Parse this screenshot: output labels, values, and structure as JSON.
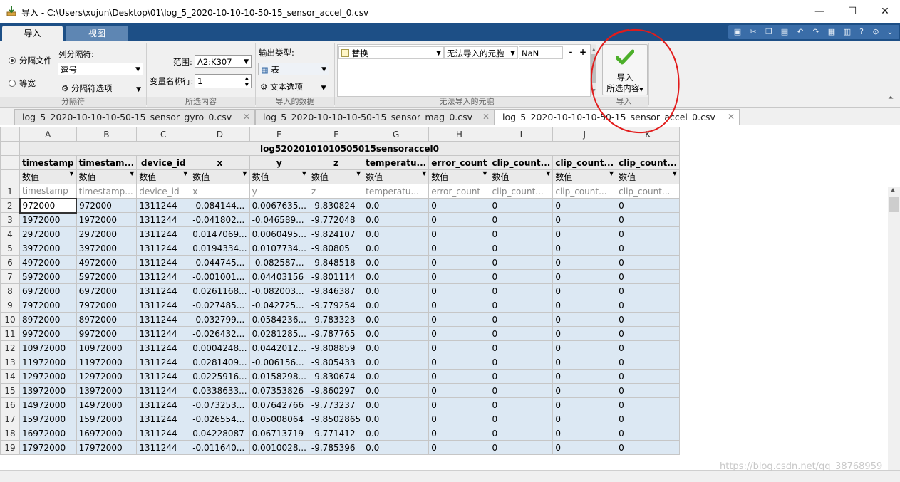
{
  "window": {
    "title": "导入 - C:\\Users\\xujun\\Desktop\\01\\log_5_2020-10-10-10-50-15_sensor_accel_0.csv",
    "controls": {
      "minimize": "—",
      "maximize": "☐",
      "close": "✕"
    }
  },
  "toolstrip_tabs": [
    {
      "label": "导入"
    },
    {
      "label": "视图"
    }
  ],
  "ribbon": {
    "delimited": {
      "radio_file": "分隔文件",
      "radio_fixed": "等宽",
      "column_delim_label": "列分隔符:",
      "column_delim_value": "逗号",
      "delim_options": "分隔符选项",
      "section": "分隔符"
    },
    "selection": {
      "range_label": "范围:",
      "range_value": "A2:K307",
      "varname_row_label": "变量名称行:",
      "varname_row_value": "1",
      "section": "所选内容"
    },
    "imported_data": {
      "output_type_label": "输出类型:",
      "output_type_value": "表",
      "text_options": "文本选项",
      "section": "导入的数据"
    },
    "unimportable": {
      "rule_action": "替换",
      "rule_condition": "无法导入的元胞",
      "rule_value": "NaN",
      "minus": "-",
      "plus": "+",
      "section": "无法导入的元胞"
    },
    "import": {
      "button_line1": "导入",
      "button_line2": "所选内容",
      "section": "导入"
    }
  },
  "doc_tabs": [
    {
      "label": "log_5_2020-10-10-10-50-15_sensor_gyro_0.csv"
    },
    {
      "label": "log_5_2020-10-10-10-50-15_sensor_mag_0.csv"
    },
    {
      "label": "log_5_2020-10-10-10-50-15_sensor_accel_0.csv",
      "active": true
    }
  ],
  "sheet": {
    "table_name": "log52020101010505015sensoraccel0",
    "column_letters": [
      "A",
      "B",
      "C",
      "D",
      "E",
      "F",
      "G",
      "H",
      "I",
      "J",
      "K"
    ],
    "var_names": [
      "timestamp",
      "timestam...",
      "device_id",
      "x",
      "y",
      "z",
      "temperatu...",
      "error_count",
      "clip_count...",
      "clip_count...",
      "clip_count..."
    ],
    "var_type": "数值",
    "header_row": [
      "timestamp",
      "timestamp...",
      "device_id",
      "x",
      "y",
      "z",
      "temperatu...",
      "error_count",
      "clip_count...",
      "clip_count...",
      "clip_count..."
    ],
    "rows": [
      [
        "972000",
        "972000",
        "1311244",
        "-0.084144...",
        "0.0067635...",
        "-9.830824",
        "0.0",
        "0",
        "0",
        "0",
        "0"
      ],
      [
        "1972000",
        "1972000",
        "1311244",
        "-0.041802...",
        "-0.046589...",
        "-9.772048",
        "0.0",
        "0",
        "0",
        "0",
        "0"
      ],
      [
        "2972000",
        "2972000",
        "1311244",
        "0.0147069...",
        "0.0060495...",
        "-9.824107",
        "0.0",
        "0",
        "0",
        "0",
        "0"
      ],
      [
        "3972000",
        "3972000",
        "1311244",
        "0.0194334...",
        "0.0107734...",
        "-9.80805",
        "0.0",
        "0",
        "0",
        "0",
        "0"
      ],
      [
        "4972000",
        "4972000",
        "1311244",
        "-0.044745...",
        "-0.082587...",
        "-9.848518",
        "0.0",
        "0",
        "0",
        "0",
        "0"
      ],
      [
        "5972000",
        "5972000",
        "1311244",
        "-0.001001...",
        "0.04403156",
        "-9.801114",
        "0.0",
        "0",
        "0",
        "0",
        "0"
      ],
      [
        "6972000",
        "6972000",
        "1311244",
        "0.0261168...",
        "-0.082003...",
        "-9.846387",
        "0.0",
        "0",
        "0",
        "0",
        "0"
      ],
      [
        "7972000",
        "7972000",
        "1311244",
        "-0.027485...",
        "-0.042725...",
        "-9.779254",
        "0.0",
        "0",
        "0",
        "0",
        "0"
      ],
      [
        "8972000",
        "8972000",
        "1311244",
        "-0.032799...",
        "0.0584236...",
        "-9.783323",
        "0.0",
        "0",
        "0",
        "0",
        "0"
      ],
      [
        "9972000",
        "9972000",
        "1311244",
        "-0.026432...",
        "0.0281285...",
        "-9.787765",
        "0.0",
        "0",
        "0",
        "0",
        "0"
      ],
      [
        "10972000",
        "10972000",
        "1311244",
        "0.0004248...",
        "0.0442012...",
        "-9.808859",
        "0.0",
        "0",
        "0",
        "0",
        "0"
      ],
      [
        "11972000",
        "11972000",
        "1311244",
        "0.0281409...",
        "-0.006156...",
        "-9.805433",
        "0.0",
        "0",
        "0",
        "0",
        "0"
      ],
      [
        "12972000",
        "12972000",
        "1311244",
        "0.0225916...",
        "0.0158298...",
        "-9.830674",
        "0.0",
        "0",
        "0",
        "0",
        "0"
      ],
      [
        "13972000",
        "13972000",
        "1311244",
        "0.0338633...",
        "0.07353826",
        "-9.860297",
        "0.0",
        "0",
        "0",
        "0",
        "0"
      ],
      [
        "14972000",
        "14972000",
        "1311244",
        "-0.073253...",
        "0.07642766",
        "-9.773237",
        "0.0",
        "0",
        "0",
        "0",
        "0"
      ],
      [
        "15972000",
        "15972000",
        "1311244",
        "-0.026554...",
        "0.05008064",
        "-9.8502865",
        "0.0",
        "0",
        "0",
        "0",
        "0"
      ],
      [
        "16972000",
        "16972000",
        "1311244",
        "0.04228087",
        "0.06713719",
        "-9.771412",
        "0.0",
        "0",
        "0",
        "0",
        "0"
      ],
      [
        "17972000",
        "17972000",
        "1311244",
        "-0.011640...",
        "0.0010028...",
        "-9.785396",
        "0.0",
        "0",
        "0",
        "0",
        "0"
      ]
    ]
  },
  "watermark": "https://blog.csdn.net/qq_38768959",
  "colors": {
    "ribbon_blue": "#1d4f86",
    "selected_cells": "#dce8f3",
    "annotation_red": "#e21b1b",
    "check_green": "#4caf2a"
  }
}
